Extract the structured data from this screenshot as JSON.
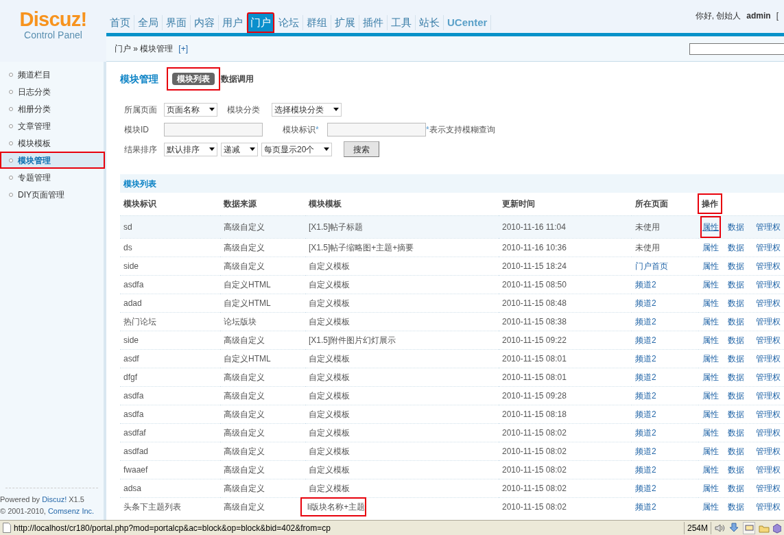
{
  "logo": {
    "title": "Discuz!",
    "subtitle": "Control Panel"
  },
  "nav_tabs": [
    {
      "label": "首页",
      "selected": false,
      "highlighted": false
    },
    {
      "label": "全局",
      "selected": false,
      "highlighted": false
    },
    {
      "label": "界面",
      "selected": false,
      "highlighted": false
    },
    {
      "label": "内容",
      "selected": false,
      "highlighted": false
    },
    {
      "label": "用户",
      "selected": false,
      "highlighted": false
    },
    {
      "label": "门户",
      "selected": true,
      "highlighted": true
    },
    {
      "label": "论坛",
      "selected": false,
      "highlighted": false
    },
    {
      "label": "群组",
      "selected": false,
      "highlighted": false
    },
    {
      "label": "扩展",
      "selected": false,
      "highlighted": false
    },
    {
      "label": "插件",
      "selected": false,
      "highlighted": false
    },
    {
      "label": "工具",
      "selected": false,
      "highlighted": false
    },
    {
      "label": "站长",
      "selected": false,
      "highlighted": false
    },
    {
      "label": "UCenter",
      "selected": false,
      "highlighted": false
    }
  ],
  "user": {
    "greeting": "你好, 创始人",
    "name": "admin",
    "bracket": "["
  },
  "breadcrumb": {
    "items": [
      "门户",
      "模块管理"
    ],
    "separator": "»",
    "add": "[+]"
  },
  "sidebar": {
    "items": [
      {
        "label": "频道栏目",
        "selected": false,
        "highlighted": false
      },
      {
        "label": "日志分类",
        "selected": false,
        "highlighted": false
      },
      {
        "label": "相册分类",
        "selected": false,
        "highlighted": false
      },
      {
        "label": "文章管理",
        "selected": false,
        "highlighted": false
      },
      {
        "label": "模块模板",
        "selected": false,
        "highlighted": false
      },
      {
        "label": "模块管理",
        "selected": true,
        "highlighted": true
      },
      {
        "label": "专题管理",
        "selected": false,
        "highlighted": false
      },
      {
        "label": "DIY页面管理",
        "selected": false,
        "highlighted": false
      }
    ],
    "footer": {
      "powered": "Powered by",
      "product": "Discuz!",
      "version": "X1.5",
      "copyright": "© 2001-2010,",
      "company": "Comsenz Inc."
    }
  },
  "page": {
    "title": "模块管理",
    "tabs": [
      {
        "label": "模块列表",
        "selected": true,
        "highlighted": true
      },
      {
        "label": "数据调用",
        "selected": false,
        "highlighted": false
      }
    ]
  },
  "filters": [
    [
      {
        "kind": "label",
        "text": "所属页面"
      },
      {
        "kind": "select",
        "value": "页面名称"
      },
      {
        "kind": "label",
        "text": "模块分类"
      },
      {
        "kind": "select",
        "value": "选择模块分类"
      }
    ],
    [
      {
        "kind": "label",
        "text": "模块ID"
      },
      {
        "kind": "input"
      },
      {
        "kind": "label",
        "text": "模块标识",
        "mark": "*"
      },
      {
        "kind": "input"
      },
      {
        "kind": "note",
        "mark": "*",
        "text": "表示支持模糊查询"
      }
    ],
    [
      {
        "kind": "label",
        "text": "结果排序"
      },
      {
        "kind": "select",
        "value": "默认排序"
      },
      {
        "kind": "select",
        "value": "递减"
      },
      {
        "kind": "select",
        "value": "每页显示20个"
      },
      {
        "kind": "button",
        "text": "搜索"
      }
    ]
  ],
  "table": {
    "title": "模块列表",
    "columns": [
      {
        "label": "模块标识",
        "highlighted": false
      },
      {
        "label": "数据来源",
        "highlighted": false
      },
      {
        "label": "模块模板",
        "highlighted": false
      },
      {
        "label": "更新时间",
        "highlighted": false
      },
      {
        "label": "所在页面",
        "highlighted": false
      },
      {
        "label": "操作",
        "highlighted": true
      }
    ],
    "rows": [
      {
        "id": "sd",
        "source": "高级自定义",
        "template": "[X1.5]帖子标题",
        "template_highlighted": false,
        "updated": "2010-11-16 11:04",
        "page": {
          "text": "未使用",
          "kind": "text"
        },
        "hovered": true,
        "actions": [
          {
            "label": "属性",
            "hovered": true,
            "highlighted": true
          },
          {
            "label": "数据",
            "hovered": false,
            "highlighted": false
          },
          {
            "label": "管理权",
            "hovered": false,
            "highlighted": false
          }
        ]
      },
      {
        "id": "ds",
        "source": "高级自定义",
        "template": "[X1.5]帖子缩略图+主题+摘要",
        "template_highlighted": false,
        "updated": "2010-11-16 10:36",
        "page": {
          "text": "未使用",
          "kind": "text"
        },
        "hovered": false,
        "actions": [
          {
            "label": "属性",
            "hovered": false,
            "highlighted": false
          },
          {
            "label": "数据",
            "hovered": false,
            "highlighted": false
          },
          {
            "label": "管理权",
            "hovered": false,
            "highlighted": false
          }
        ]
      },
      {
        "id": "side",
        "source": "高级自定义",
        "template": "自定义模板",
        "template_highlighted": false,
        "updated": "2010-11-15 18:24",
        "page": {
          "text": "门户首页",
          "kind": "link"
        },
        "hovered": false,
        "actions": [
          {
            "label": "属性",
            "hovered": false,
            "highlighted": false
          },
          {
            "label": "数据",
            "hovered": false,
            "highlighted": false
          },
          {
            "label": "管理权",
            "hovered": false,
            "highlighted": false
          }
        ]
      },
      {
        "id": "asdfa",
        "source": "自定义HTML",
        "template": "自定义模板",
        "template_highlighted": false,
        "updated": "2010-11-15 08:50",
        "page": {
          "text": "频道2",
          "kind": "link"
        },
        "hovered": false,
        "actions": [
          {
            "label": "属性",
            "hovered": false,
            "highlighted": false
          },
          {
            "label": "数据",
            "hovered": false,
            "highlighted": false
          },
          {
            "label": "管理权",
            "hovered": false,
            "highlighted": false
          }
        ]
      },
      {
        "id": "adad",
        "source": "自定义HTML",
        "template": "自定义模板",
        "template_highlighted": false,
        "updated": "2010-11-15 08:48",
        "page": {
          "text": "频道2",
          "kind": "link"
        },
        "hovered": false,
        "actions": [
          {
            "label": "属性",
            "hovered": false,
            "highlighted": false
          },
          {
            "label": "数据",
            "hovered": false,
            "highlighted": false
          },
          {
            "label": "管理权",
            "hovered": false,
            "highlighted": false
          }
        ]
      },
      {
        "id": "热门论坛",
        "source": "论坛版块",
        "template": "自定义模板",
        "template_highlighted": false,
        "updated": "2010-11-15 08:38",
        "page": {
          "text": "频道2",
          "kind": "link"
        },
        "hovered": false,
        "actions": [
          {
            "label": "属性",
            "hovered": false,
            "highlighted": false
          },
          {
            "label": "数据",
            "hovered": false,
            "highlighted": false
          },
          {
            "label": "管理权",
            "hovered": false,
            "highlighted": false
          }
        ]
      },
      {
        "id": "side",
        "source": "高级自定义",
        "template": "[X1.5]附件图片幻灯展示",
        "template_highlighted": false,
        "updated": "2010-11-15 09:22",
        "page": {
          "text": "频道2",
          "kind": "link"
        },
        "hovered": false,
        "actions": [
          {
            "label": "属性",
            "hovered": false,
            "highlighted": false
          },
          {
            "label": "数据",
            "hovered": false,
            "highlighted": false
          },
          {
            "label": "管理权",
            "hovered": false,
            "highlighted": false
          }
        ]
      },
      {
        "id": "asdf",
        "source": "自定义HTML",
        "template": "自定义模板",
        "template_highlighted": false,
        "updated": "2010-11-15 08:01",
        "page": {
          "text": "频道2",
          "kind": "link"
        },
        "hovered": false,
        "actions": [
          {
            "label": "属性",
            "hovered": false,
            "highlighted": false
          },
          {
            "label": "数据",
            "hovered": false,
            "highlighted": false
          },
          {
            "label": "管理权",
            "hovered": false,
            "highlighted": false
          }
        ]
      },
      {
        "id": "dfgf",
        "source": "高级自定义",
        "template": "自定义模板",
        "template_highlighted": false,
        "updated": "2010-11-15 08:01",
        "page": {
          "text": "频道2",
          "kind": "link"
        },
        "hovered": false,
        "actions": [
          {
            "label": "属性",
            "hovered": false,
            "highlighted": false
          },
          {
            "label": "数据",
            "hovered": false,
            "highlighted": false
          },
          {
            "label": "管理权",
            "hovered": false,
            "highlighted": false
          }
        ]
      },
      {
        "id": "asdfa",
        "source": "高级自定义",
        "template": "自定义模板",
        "template_highlighted": false,
        "updated": "2010-11-15 09:28",
        "page": {
          "text": "频道2",
          "kind": "link"
        },
        "hovered": false,
        "actions": [
          {
            "label": "属性",
            "hovered": false,
            "highlighted": false
          },
          {
            "label": "数据",
            "hovered": false,
            "highlighted": false
          },
          {
            "label": "管理权",
            "hovered": false,
            "highlighted": false
          }
        ]
      },
      {
        "id": "asdfa",
        "source": "高级自定义",
        "template": "自定义模板",
        "template_highlighted": false,
        "updated": "2010-11-15 08:18",
        "page": {
          "text": "频道2",
          "kind": "link"
        },
        "hovered": false,
        "actions": [
          {
            "label": "属性",
            "hovered": false,
            "highlighted": false
          },
          {
            "label": "数据",
            "hovered": false,
            "highlighted": false
          },
          {
            "label": "管理权",
            "hovered": false,
            "highlighted": false
          }
        ]
      },
      {
        "id": "asdfaf",
        "source": "高级自定义",
        "template": "自定义模板",
        "template_highlighted": false,
        "updated": "2010-11-15 08:02",
        "page": {
          "text": "频道2",
          "kind": "link"
        },
        "hovered": false,
        "actions": [
          {
            "label": "属性",
            "hovered": false,
            "highlighted": false
          },
          {
            "label": "数据",
            "hovered": false,
            "highlighted": false
          },
          {
            "label": "管理权",
            "hovered": false,
            "highlighted": false
          }
        ]
      },
      {
        "id": "asdfad",
        "source": "高级自定义",
        "template": "自定义模板",
        "template_highlighted": false,
        "updated": "2010-11-15 08:02",
        "page": {
          "text": "频道2",
          "kind": "link"
        },
        "hovered": false,
        "actions": [
          {
            "label": "属性",
            "hovered": false,
            "highlighted": false
          },
          {
            "label": "数据",
            "hovered": false,
            "highlighted": false
          },
          {
            "label": "管理权",
            "hovered": false,
            "highlighted": false
          }
        ]
      },
      {
        "id": "fwaaef",
        "source": "高级自定义",
        "template": "自定义模板",
        "template_highlighted": false,
        "updated": "2010-11-15 08:02",
        "page": {
          "text": "频道2",
          "kind": "link"
        },
        "hovered": false,
        "actions": [
          {
            "label": "属性",
            "hovered": false,
            "highlighted": false
          },
          {
            "label": "数据",
            "hovered": false,
            "highlighted": false
          },
          {
            "label": "管理权",
            "hovered": false,
            "highlighted": false
          }
        ]
      },
      {
        "id": "adsa",
        "source": "高级自定义",
        "template": "自定义模板",
        "template_highlighted": false,
        "updated": "2010-11-15 08:02",
        "page": {
          "text": "频道2",
          "kind": "link"
        },
        "hovered": false,
        "actions": [
          {
            "label": "属性",
            "hovered": false,
            "highlighted": false
          },
          {
            "label": "数据",
            "hovered": false,
            "highlighted": false
          },
          {
            "label": "管理权",
            "hovered": false,
            "highlighted": false
          }
        ]
      },
      {
        "id": "头条下主题列表",
        "source": "高级自定义",
        "template": "li版块名称+主题",
        "template_highlighted": true,
        "updated": "2010-11-15 08:02",
        "page": {
          "text": "频道2",
          "kind": "link"
        },
        "hovered": false,
        "actions": [
          {
            "label": "属性",
            "hovered": false,
            "highlighted": false
          },
          {
            "label": "数据",
            "hovered": false,
            "highlighted": false
          },
          {
            "label": "管理权",
            "hovered": false,
            "highlighted": false
          }
        ]
      }
    ]
  },
  "status_bar": {
    "url": "http://localhost/cr180/portal.php?mod=portalcp&ac=block&op=block&bid=402&from=cp",
    "memory": "254M"
  }
}
